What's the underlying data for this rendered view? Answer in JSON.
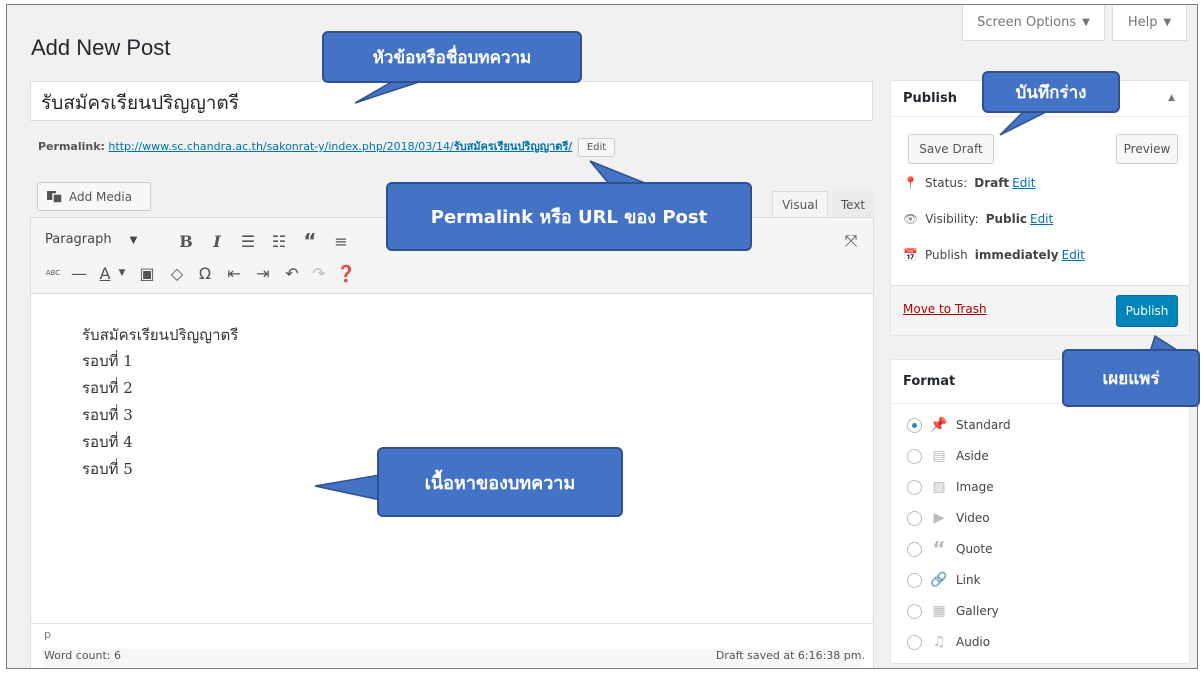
{
  "header": {
    "page_title": "Add New Post",
    "screen_options": "Screen Options",
    "help": "Help"
  },
  "post": {
    "title": "รับสมัครเรียนปริญญาตรี",
    "permalink_label": "Permalink:",
    "permalink_url": "http://www.sc.chandra.ac.th/sakonrat-y/index.php/2018/03/14/",
    "permalink_slug": "รับสมัครเรียนปริญญาตรี/",
    "permalink_edit": "Edit"
  },
  "editor": {
    "add_media": "Add Media",
    "tab_visual": "Visual",
    "tab_text": "Text",
    "format_select": "Paragraph",
    "content_lines": [
      "รับสมัครเรียนปริญญาตรี",
      "รอบที่ 1",
      "รอบที่ 2",
      "รอบที่ 3",
      "รอบที่ 4",
      "รอบที่ 5"
    ],
    "path": "p",
    "word_count": "Word count: 6",
    "draft_saved": "Draft saved at 6:16:38 pm."
  },
  "publish_box": {
    "title": "Publish",
    "save_draft": "Save Draft",
    "preview": "Preview",
    "status_label": "Status:",
    "status_value": "Draft",
    "visibility_label": "Visibility:",
    "visibility_value": "Public",
    "publish_label": "Publish",
    "publish_value": "immediately",
    "edit": "Edit",
    "move_to_trash": "Move to Trash",
    "publish_button": "Publish"
  },
  "format_box": {
    "title": "Format",
    "options": [
      "Standard",
      "Aside",
      "Image",
      "Video",
      "Quote",
      "Link",
      "Gallery",
      "Audio"
    ],
    "selected": "Standard"
  },
  "callouts": {
    "title_note": "หัวข้อหรือชื่อบทความ",
    "save_draft_note": "บันทึกร่าง",
    "permalink_note": "Permalink หรือ URL ของ Post",
    "content_note": "เนื้อหาของบทความ",
    "publish_note": "เผยแพร่"
  },
  "colors": {
    "accent": "#0085ba",
    "callout": "#4472c4",
    "link": "#0073aa",
    "trash": "#a00000"
  }
}
